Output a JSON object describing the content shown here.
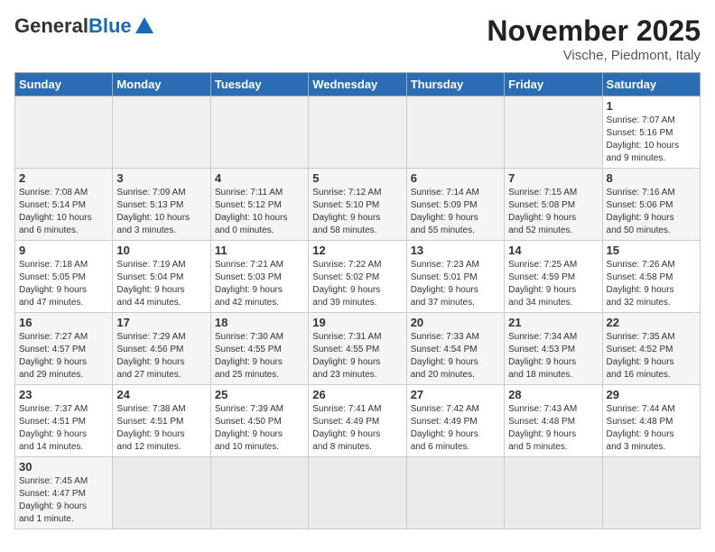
{
  "header": {
    "logo_general": "General",
    "logo_blue": "Blue",
    "month_title": "November 2025",
    "subtitle": "Vische, Piedmont, Italy"
  },
  "weekdays": [
    "Sunday",
    "Monday",
    "Tuesday",
    "Wednesday",
    "Thursday",
    "Friday",
    "Saturday"
  ],
  "weeks": [
    [
      {
        "day": "",
        "info": "",
        "empty": true
      },
      {
        "day": "",
        "info": "",
        "empty": true
      },
      {
        "day": "",
        "info": "",
        "empty": true
      },
      {
        "day": "",
        "info": "",
        "empty": true
      },
      {
        "day": "",
        "info": "",
        "empty": true
      },
      {
        "day": "",
        "info": "",
        "empty": true
      },
      {
        "day": "1",
        "info": "Sunrise: 7:07 AM\nSunset: 5:16 PM\nDaylight: 10 hours\nand 9 minutes."
      }
    ],
    [
      {
        "day": "2",
        "info": "Sunrise: 7:08 AM\nSunset: 5:14 PM\nDaylight: 10 hours\nand 6 minutes."
      },
      {
        "day": "3",
        "info": "Sunrise: 7:09 AM\nSunset: 5:13 PM\nDaylight: 10 hours\nand 3 minutes."
      },
      {
        "day": "4",
        "info": "Sunrise: 7:11 AM\nSunset: 5:12 PM\nDaylight: 10 hours\nand 0 minutes."
      },
      {
        "day": "5",
        "info": "Sunrise: 7:12 AM\nSunset: 5:10 PM\nDaylight: 9 hours\nand 58 minutes."
      },
      {
        "day": "6",
        "info": "Sunrise: 7:14 AM\nSunset: 5:09 PM\nDaylight: 9 hours\nand 55 minutes."
      },
      {
        "day": "7",
        "info": "Sunrise: 7:15 AM\nSunset: 5:08 PM\nDaylight: 9 hours\nand 52 minutes."
      },
      {
        "day": "8",
        "info": "Sunrise: 7:16 AM\nSunset: 5:06 PM\nDaylight: 9 hours\nand 50 minutes."
      }
    ],
    [
      {
        "day": "9",
        "info": "Sunrise: 7:18 AM\nSunset: 5:05 PM\nDaylight: 9 hours\nand 47 minutes."
      },
      {
        "day": "10",
        "info": "Sunrise: 7:19 AM\nSunset: 5:04 PM\nDaylight: 9 hours\nand 44 minutes."
      },
      {
        "day": "11",
        "info": "Sunrise: 7:21 AM\nSunset: 5:03 PM\nDaylight: 9 hours\nand 42 minutes."
      },
      {
        "day": "12",
        "info": "Sunrise: 7:22 AM\nSunset: 5:02 PM\nDaylight: 9 hours\nand 39 minutes."
      },
      {
        "day": "13",
        "info": "Sunrise: 7:23 AM\nSunset: 5:01 PM\nDaylight: 9 hours\nand 37 minutes."
      },
      {
        "day": "14",
        "info": "Sunrise: 7:25 AM\nSunset: 4:59 PM\nDaylight: 9 hours\nand 34 minutes."
      },
      {
        "day": "15",
        "info": "Sunrise: 7:26 AM\nSunset: 4:58 PM\nDaylight: 9 hours\nand 32 minutes."
      }
    ],
    [
      {
        "day": "16",
        "info": "Sunrise: 7:27 AM\nSunset: 4:57 PM\nDaylight: 9 hours\nand 29 minutes."
      },
      {
        "day": "17",
        "info": "Sunrise: 7:29 AM\nSunset: 4:56 PM\nDaylight: 9 hours\nand 27 minutes."
      },
      {
        "day": "18",
        "info": "Sunrise: 7:30 AM\nSunset: 4:55 PM\nDaylight: 9 hours\nand 25 minutes."
      },
      {
        "day": "19",
        "info": "Sunrise: 7:31 AM\nSunset: 4:55 PM\nDaylight: 9 hours\nand 23 minutes."
      },
      {
        "day": "20",
        "info": "Sunrise: 7:33 AM\nSunset: 4:54 PM\nDaylight: 9 hours\nand 20 minutes."
      },
      {
        "day": "21",
        "info": "Sunrise: 7:34 AM\nSunset: 4:53 PM\nDaylight: 9 hours\nand 18 minutes."
      },
      {
        "day": "22",
        "info": "Sunrise: 7:35 AM\nSunset: 4:52 PM\nDaylight: 9 hours\nand 16 minutes."
      }
    ],
    [
      {
        "day": "23",
        "info": "Sunrise: 7:37 AM\nSunset: 4:51 PM\nDaylight: 9 hours\nand 14 minutes."
      },
      {
        "day": "24",
        "info": "Sunrise: 7:38 AM\nSunset: 4:51 PM\nDaylight: 9 hours\nand 12 minutes."
      },
      {
        "day": "25",
        "info": "Sunrise: 7:39 AM\nSunset: 4:50 PM\nDaylight: 9 hours\nand 10 minutes."
      },
      {
        "day": "26",
        "info": "Sunrise: 7:41 AM\nSunset: 4:49 PM\nDaylight: 9 hours\nand 8 minutes."
      },
      {
        "day": "27",
        "info": "Sunrise: 7:42 AM\nSunset: 4:49 PM\nDaylight: 9 hours\nand 6 minutes."
      },
      {
        "day": "28",
        "info": "Sunrise: 7:43 AM\nSunset: 4:48 PM\nDaylight: 9 hours\nand 5 minutes."
      },
      {
        "day": "29",
        "info": "Sunrise: 7:44 AM\nSunset: 4:48 PM\nDaylight: 9 hours\nand 3 minutes."
      }
    ],
    [
      {
        "day": "30",
        "info": "Sunrise: 7:45 AM\nSunset: 4:47 PM\nDaylight: 9 hours\nand 1 minute."
      },
      {
        "day": "",
        "info": "",
        "empty": true
      },
      {
        "day": "",
        "info": "",
        "empty": true
      },
      {
        "day": "",
        "info": "",
        "empty": true
      },
      {
        "day": "",
        "info": "",
        "empty": true
      },
      {
        "day": "",
        "info": "",
        "empty": true
      },
      {
        "day": "",
        "info": "",
        "empty": true
      }
    ]
  ]
}
